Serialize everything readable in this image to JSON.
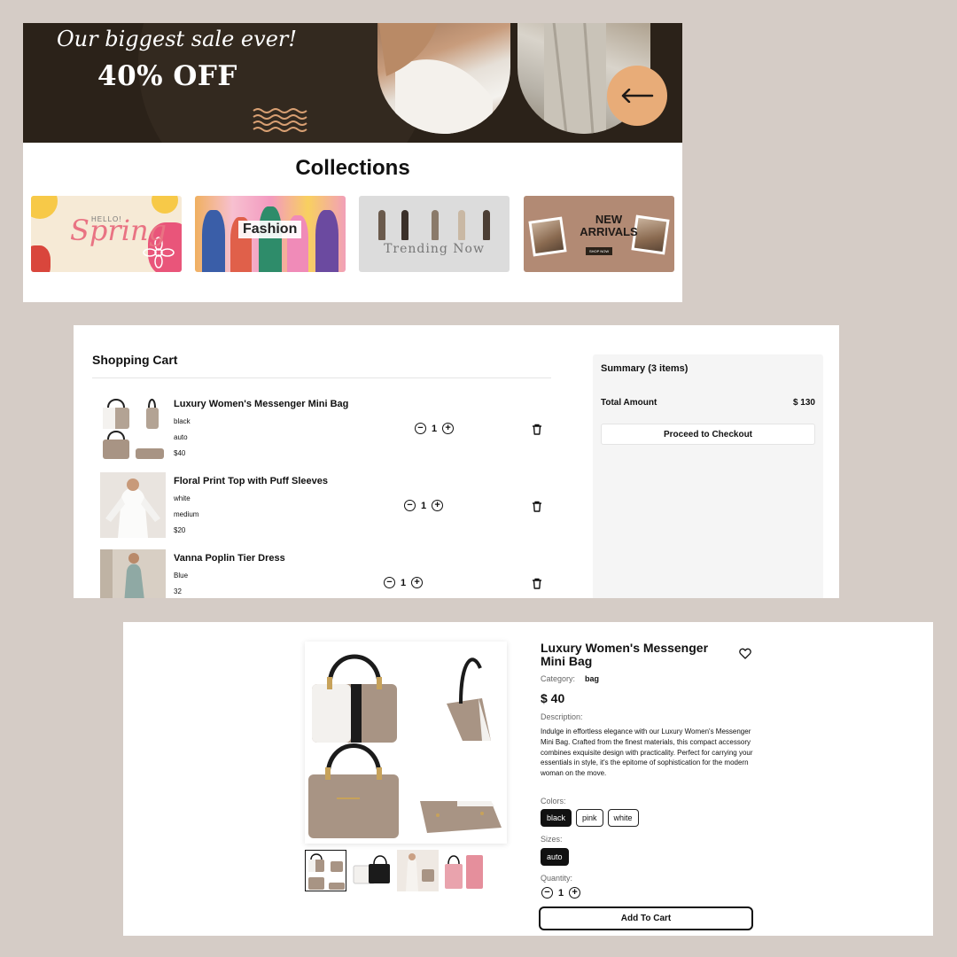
{
  "hero": {
    "tagline": "Our biggest sale ever!",
    "discount": "40% OFF",
    "arrow_icon": "arrow-left-icon"
  },
  "collections": {
    "title": "Collections",
    "cards": [
      {
        "name": "spring",
        "top_text": "HELLO!",
        "main_text": "Spring"
      },
      {
        "name": "fashion",
        "main_text": "Fashion"
      },
      {
        "name": "trending",
        "main_text": "Trending Now"
      },
      {
        "name": "new-arrivals",
        "main_text": "NEW ARRIVALS",
        "button_text": "SHOP NOW"
      }
    ]
  },
  "cart": {
    "title": "Shopping Cart",
    "items": [
      {
        "name": "Luxury Women's Messenger Mini Bag",
        "color": "black",
        "size": "auto",
        "price": "$40",
        "quantity": "1"
      },
      {
        "name": "Floral Print Top with Puff Sleeves",
        "color": "white",
        "size": "medium",
        "price": "$20",
        "quantity": "1"
      },
      {
        "name": "Vanna Poplin Tier Dress",
        "color": "Blue",
        "size": "32",
        "price": "",
        "quantity": "1"
      }
    ],
    "summary": {
      "title": "Summary (3 items)",
      "total_label": "Total Amount",
      "total_value": "$ 130",
      "checkout_label": "Proceed to Checkout"
    }
  },
  "product": {
    "title": "Luxury Women's Messenger Mini Bag",
    "category_label": "Category:",
    "category_value": "bag",
    "price": "$ 40",
    "description_label": "Description:",
    "description": "Indulge in effortless elegance with our Luxury Women's Messenger Mini Bag. Crafted from the finest materials, this compact accessory combines exquisite design with practicality. Perfect for carrying your essentials in style, it's the epitome of sophistication for the modern woman on the move.",
    "colors_label": "Colors:",
    "colors": [
      "black",
      "pink",
      "white"
    ],
    "selected_color": "black",
    "sizes_label": "Sizes:",
    "sizes": [
      "auto"
    ],
    "selected_size": "auto",
    "quantity_label": "Quantity:",
    "quantity": "1",
    "add_to_cart_label": "Add To Cart"
  },
  "theme": {
    "background": "#d5ccc6",
    "hero_dark": "#2b2219",
    "accent_peach": "#e8ac78",
    "taupe": "#a89484"
  }
}
